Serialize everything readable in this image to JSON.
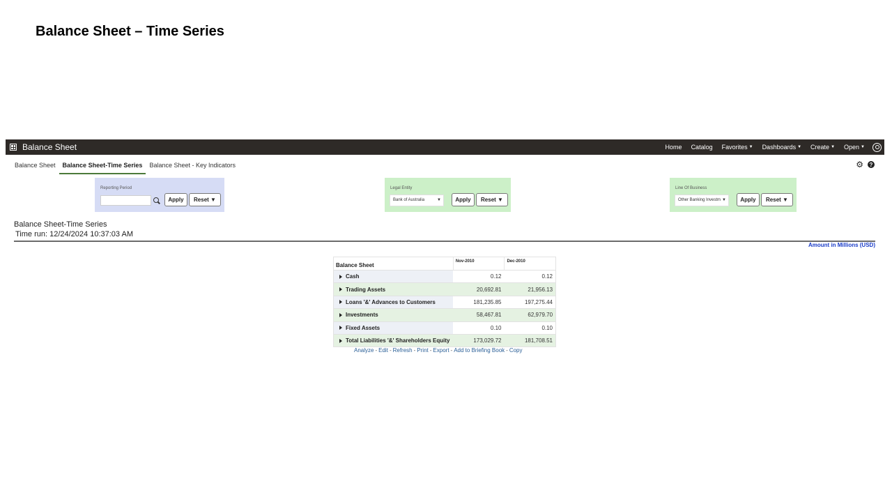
{
  "slide": {
    "title": "Balance Sheet – Time Series"
  },
  "topbar": {
    "title": "Balance Sheet",
    "nav": [
      "Home",
      "Catalog",
      "Favorites",
      "Dashboards",
      "Create",
      "Open"
    ]
  },
  "tabs": [
    "Balance Sheet",
    "Balance Sheet-Time Series",
    "Balance Sheet - Key Indicators"
  ],
  "active_tab": "Balance Sheet-Time Series",
  "prompts": {
    "reporting_period": {
      "label": "Reporting Period",
      "value": "",
      "apply": "Apply",
      "reset": "Reset ▼"
    },
    "legal_entity": {
      "label": "Legal Entity",
      "value": "Bank of Australia",
      "apply": "Apply",
      "reset": "Reset ▼"
    },
    "line_of_business": {
      "label": "Line Of Business",
      "value": "Other Banking Investm",
      "apply": "Apply",
      "reset": "Reset ▼"
    }
  },
  "report": {
    "title": "Balance Sheet-Time Series",
    "time_run": "Time run: 12/24/2024 10:37:03 AM",
    "amount_note": "Amount in Millions (USD)"
  },
  "table": {
    "header": [
      "Balance Sheet",
      "Nov-2010",
      "Dec-2010"
    ],
    "rows": [
      {
        "label": "Cash",
        "v1": "0.12",
        "v2": "0.12"
      },
      {
        "label": "Trading Assets",
        "v1": "20,692.81",
        "v2": "21,956.13"
      },
      {
        "label": "Loans '&' Advances to Customers",
        "v1": "181,235.85",
        "v2": "197,275.44"
      },
      {
        "label": "Investments",
        "v1": "58,467.81",
        "v2": "62,979.70"
      },
      {
        "label": "Fixed Assets",
        "v1": "0.10",
        "v2": "0.10"
      },
      {
        "label": "Total Liabilities '&' Shareholders Equity",
        "v1": "173,029.72",
        "v2": "181,708.51"
      }
    ]
  },
  "links": [
    "Analyze",
    "Edit",
    "Refresh",
    "Print",
    "Export",
    "Add to Briefing Book",
    "Copy"
  ]
}
